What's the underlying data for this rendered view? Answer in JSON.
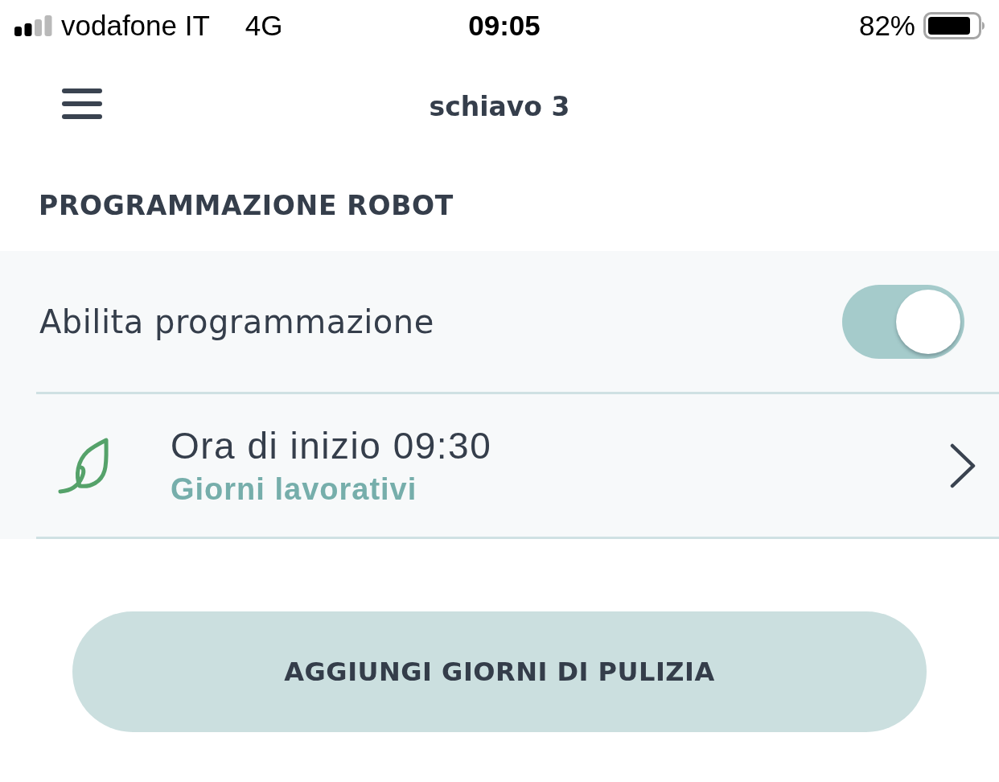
{
  "status_bar": {
    "carrier": "vodafone IT",
    "network": "4G",
    "time": "09:05",
    "battery_percent": "82%"
  },
  "nav_bar": {
    "title": "schiavo 3"
  },
  "section": {
    "title": "PROGRAMMAZIONE ROBOT"
  },
  "settings": [
    {
      "kind": "toggle",
      "label": "Abilita programmazione",
      "on": true
    },
    {
      "kind": "schedule",
      "title": "Ora di inizio 09:30",
      "subtitle": "Giorni lavorativi"
    }
  ],
  "primary_button": {
    "label": "AGGIUNGI GIORNI DI PULIZIA"
  }
}
